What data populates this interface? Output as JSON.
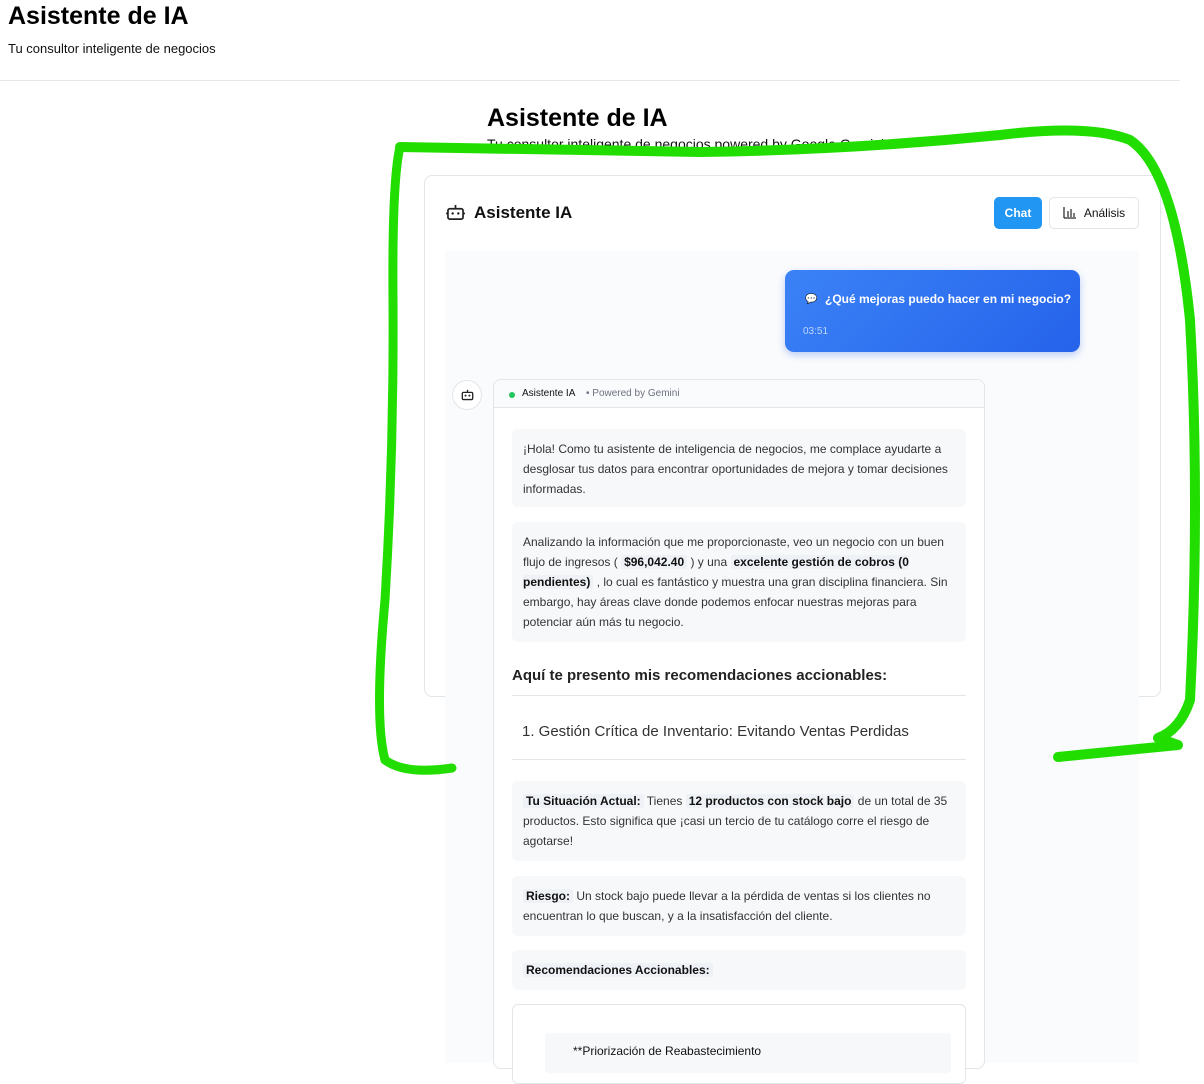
{
  "top_header": {
    "title": "Asistente de IA",
    "subtitle": "Tu consultor inteligente de negocios"
  },
  "page": {
    "title": "Asistente de IA",
    "subtitle": "Tu consultor inteligente de negocios powered by Google Gemini"
  },
  "card": {
    "title": "Asistente IA",
    "tabs": {
      "chat": "Chat",
      "analysis": "Análisis"
    }
  },
  "user_message": {
    "text": "¿Qué mejoras puedo hacer en mi negocio?",
    "time": "03:51"
  },
  "bot_message": {
    "name": "Asistente IA",
    "powered": "• Powered by Gemini",
    "p1": "¡Hola! Como tu asistente de inteligencia de negocios, me complace ayudarte a desglosar tus datos para encontrar oportunidades de mejora y tomar decisiones informadas.",
    "p2_a": "Analizando la información que me proporcionaste, veo un negocio con un buen flujo de ingresos (",
    "p2_amount": "$96,042.40",
    "p2_b": ") y una",
    "p2_strong": "excelente gestión de cobros (0 pendientes)",
    "p2_c": ", lo cual es fantástico y muestra una gran disciplina financiera. Sin embargo, hay áreas clave donde podemos enfocar nuestras mejoras para potenciar aún más tu negocio.",
    "rec_heading": "Aquí te presento mis recomendaciones accionables:",
    "section1_title": "1. Gestión Crítica de Inventario: Evitando Ventas Perdidas",
    "situation_label": "Tu Situación Actual:",
    "situation_a": "Tienes",
    "situation_strong": "12 productos con stock bajo",
    "situation_b": "de un total de 35 productos. Esto significa que ¡casi un tercio de tu catálogo corre el riesgo de agotarse!",
    "risk_label": "Riesgo:",
    "risk_text": "Un stock bajo puede llevar a la pérdida de ventas si los clientes no encuentran lo que buscan, y a la insatisfacción del cliente.",
    "actions_label": "Recomendaciones Accionables:",
    "priority_text": "**Priorización de Reabastecimiento"
  },
  "colors": {
    "accent": "#2196f3",
    "user_bubble": "#2563eb",
    "annotation": "#22dd00",
    "status_online": "#22c55e"
  },
  "icons": {
    "card_head": "robot-icon",
    "analysis": "bar-chart-icon",
    "user_msg": "speech-bubble-icon",
    "bot_avatar": "robot-icon"
  }
}
